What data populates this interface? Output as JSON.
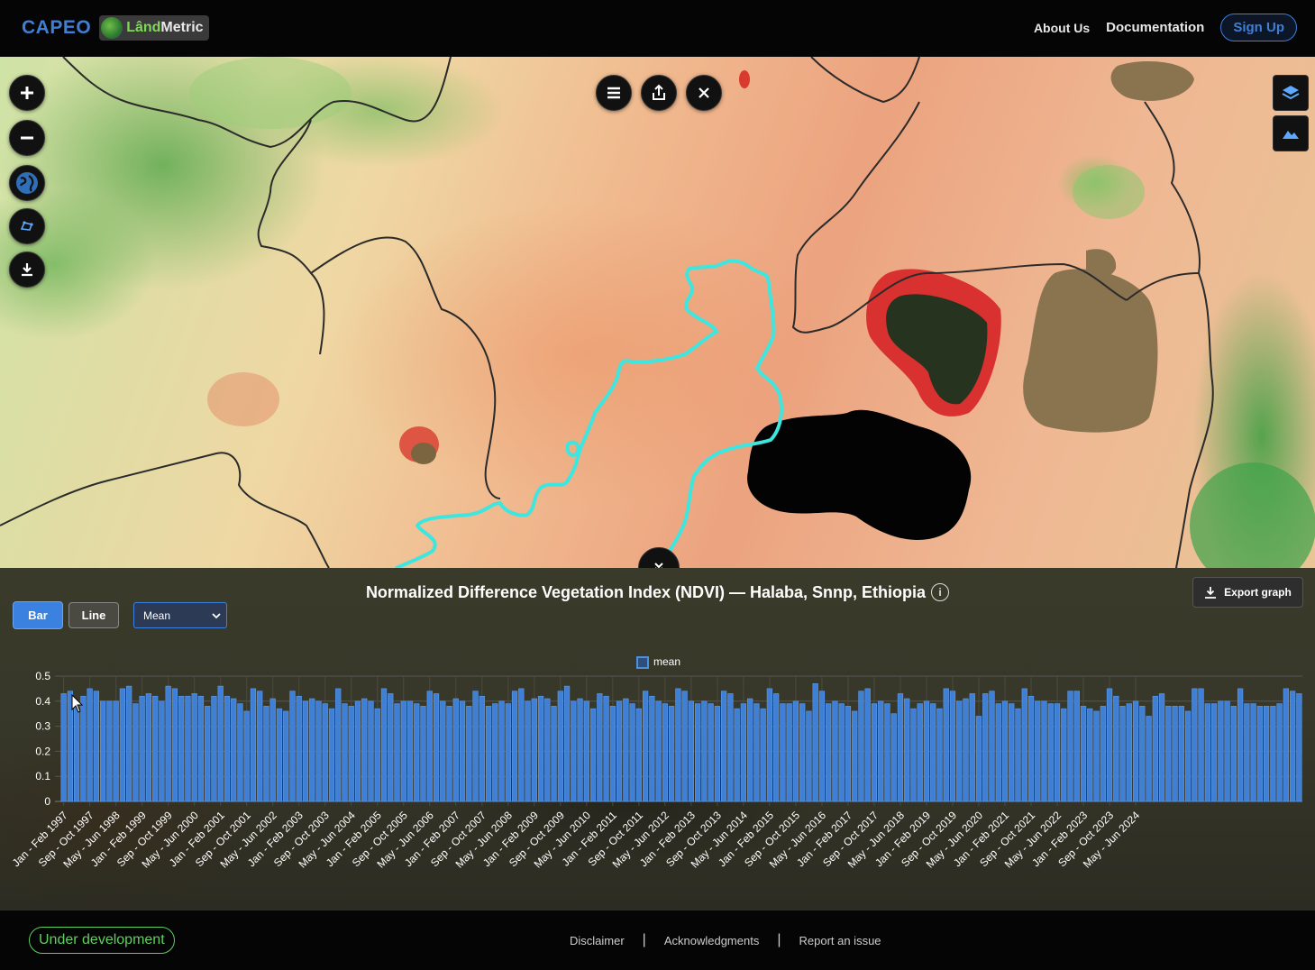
{
  "header": {
    "brand": "CAPEO",
    "logo_part1": "Lând",
    "logo_part2": "Metric",
    "nav": [
      "About Us",
      "Documentation"
    ],
    "signup": "Sign Up"
  },
  "map_controls": {
    "left": [
      "zoom-in",
      "zoom-out",
      "basemap-globe",
      "draw-area",
      "download"
    ],
    "top": [
      "menu",
      "share",
      "close"
    ],
    "right": [
      "layers",
      "terrain"
    ]
  },
  "panel": {
    "title": "Normalized Difference Vegetation Index (NDVI) — Halaba, Snnp, Ethiopia",
    "info": "i",
    "export_label": "Export graph",
    "bar_label": "Bar",
    "line_label": "Line",
    "statistic": "Mean"
  },
  "chart_data": {
    "type": "bar",
    "legend": [
      "mean"
    ],
    "legend_placement": "top-center",
    "ylim": [
      0,
      0.5
    ],
    "yticks": [
      0,
      0.1,
      0.2,
      0.3,
      0.4,
      0.5
    ],
    "grid": true,
    "bar_color": "#4a8fe0",
    "x_tick_labels": [
      "Jan - Feb 1997",
      "Sep - Oct 1997",
      "May - Jun 1998",
      "Jan - Feb 1999",
      "Sep - Oct 1999",
      "May - Jun 2000",
      "Jan - Feb 2001",
      "Sep - Oct 2001",
      "May - Jun 2002",
      "Jan - Feb 2003",
      "Sep - Oct 2003",
      "May - Jun 2004",
      "Jan - Feb 2005",
      "Sep - Oct 2005",
      "May - Jun 2006",
      "Jan - Feb 2007",
      "Sep - Oct 2007",
      "May - Jun 2008",
      "Jan - Feb 2009",
      "Sep - Oct 2009",
      "May - Jun 2010",
      "Jan - Feb 2011",
      "Sep - Oct 2011",
      "May - Jun 2012",
      "Jan - Feb 2013",
      "Sep - Oct 2013",
      "May - Jun 2014",
      "Jan - Feb 2015",
      "Sep - Oct 2015",
      "May - Jun 2016",
      "Jan - Feb 2017",
      "Sep - Oct 2017",
      "May - Jun 2018",
      "Jan - Feb 2019",
      "Sep - Oct 2019",
      "May - Jun 2020",
      "Jan - Feb 2021",
      "Sep - Oct 2021",
      "May - Jun 2022",
      "Jan - Feb 2023",
      "Sep - Oct 2023",
      "May - Jun 2024"
    ],
    "series": [
      {
        "name": "mean",
        "values": [
          0.43,
          0.44,
          0.39,
          0.42,
          0.45,
          0.44,
          0.4,
          0.4,
          0.4,
          0.45,
          0.46,
          0.39,
          0.42,
          0.43,
          0.42,
          0.4,
          0.46,
          0.45,
          0.42,
          0.42,
          0.43,
          0.42,
          0.38,
          0.42,
          0.46,
          0.42,
          0.41,
          0.39,
          0.36,
          0.45,
          0.44,
          0.38,
          0.41,
          0.37,
          0.36,
          0.44,
          0.42,
          0.4,
          0.41,
          0.4,
          0.39,
          0.37,
          0.45,
          0.39,
          0.38,
          0.4,
          0.41,
          0.4,
          0.37,
          0.45,
          0.43,
          0.39,
          0.4,
          0.4,
          0.39,
          0.38,
          0.44,
          0.43,
          0.4,
          0.38,
          0.41,
          0.4,
          0.38,
          0.44,
          0.42,
          0.38,
          0.39,
          0.4,
          0.39,
          0.44,
          0.45,
          0.4,
          0.41,
          0.42,
          0.41,
          0.38,
          0.44,
          0.46,
          0.4,
          0.41,
          0.4,
          0.37,
          0.43,
          0.42,
          0.38,
          0.4,
          0.41,
          0.39,
          0.37,
          0.44,
          0.42,
          0.4,
          0.39,
          0.38,
          0.45,
          0.44,
          0.4,
          0.39,
          0.4,
          0.39,
          0.38,
          0.44,
          0.43,
          0.37,
          0.39,
          0.41,
          0.39,
          0.37,
          0.45,
          0.43,
          0.39,
          0.39,
          0.4,
          0.39,
          0.36,
          0.47,
          0.44,
          0.39,
          0.4,
          0.39,
          0.38,
          0.36,
          0.44,
          0.45,
          0.39,
          0.4,
          0.39,
          0.35,
          0.43,
          0.41,
          0.37,
          0.39,
          0.4,
          0.39,
          0.37,
          0.45,
          0.44,
          0.4,
          0.41,
          0.43,
          0.34,
          0.43,
          0.44,
          0.39,
          0.4,
          0.39,
          0.37,
          0.45,
          0.42,
          0.4,
          0.4,
          0.39,
          0.39,
          0.37,
          0.44,
          0.44,
          0.38,
          0.37,
          0.36,
          0.38,
          0.45,
          0.42,
          0.38,
          0.39,
          0.4,
          0.38,
          0.34,
          0.42,
          0.43,
          0.38,
          0.38,
          0.38,
          0.36,
          0.45,
          0.45,
          0.39,
          0.39,
          0.4,
          0.4,
          0.38,
          0.45,
          0.39,
          0.39,
          0.38,
          0.38,
          0.38,
          0.39,
          0.45,
          0.44,
          0.43
        ]
      }
    ]
  },
  "footer": {
    "badge": "Under development",
    "links": [
      "Disclaimer",
      "Acknowledgments",
      "Report an issue"
    ]
  }
}
